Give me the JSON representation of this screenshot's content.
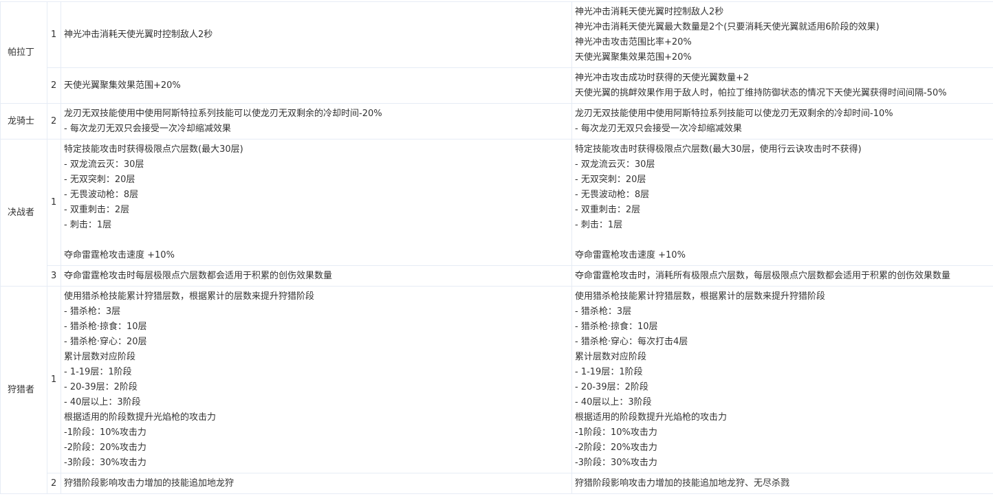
{
  "rows": [
    {
      "class": "帕拉丁",
      "entries": [
        {
          "level": "1",
          "before": [
            "神光冲击消耗天使光翼时控制敌人2秒"
          ],
          "after": [
            "神光冲击消耗天使光翼时控制敌人2秒",
            "神光冲击消耗天使光翼最大数量是2个(只要消耗天使光翼就适用6阶段的效果)",
            "神光冲击攻击范围比率+20%",
            "天使光翼聚集效果范围+20%"
          ]
        },
        {
          "level": "2",
          "before": [
            "天使光翼聚集效果范围+20%"
          ],
          "after": [
            "神光冲击攻击成功时获得的天使光翼数量+2",
            "天使光翼的挑衅效果作用于敌人时，帕拉丁维持防御状态的情况下天使光翼获得时间间隔-50%"
          ]
        }
      ]
    },
    {
      "class": "龙骑士",
      "entries": [
        {
          "level": "2",
          "before": [
            "龙刃无双技能使用中使用阿斯特拉系列技能可以使龙刃无双剩余的冷却时间-20%",
            "- 每次龙刃无双只会接受一次冷却缩减效果"
          ],
          "after": [
            "龙刃无双技能使用中使用阿斯特拉系列技能可以使龙刃无双剩余的冷却时间-10%",
            "- 每次龙刃无双只会接受一次冷却缩减效果"
          ]
        }
      ]
    },
    {
      "class": "决战者",
      "entries": [
        {
          "level": "1",
          "before": [
            "特定技能攻击时获得极限点穴层数(最大30层)",
            "- 双龙流云灭：30层",
            "- 无双突刺：20层",
            "- 无畏波动枪：8层",
            "- 双重刺击：2层",
            "- 刺击：1层",
            "",
            "夺命雷霆枪攻击速度 +10%"
          ],
          "after": [
            "特定技能攻击时获得极限点穴层数(最大30层，使用行云诀攻击时不获得)",
            "- 双龙流云灭：30层",
            "- 无双突刺：20层",
            "- 无畏波动枪：8层",
            "- 双重刺击：2层",
            "- 刺击：1层",
            "",
            "夺命雷霆枪攻击速度 +10%"
          ]
        },
        {
          "level": "3",
          "before": [
            "夺命雷霆枪攻击时每层极限点穴层数都会适用于积累的创伤效果数量"
          ],
          "after": [
            "夺命雷霆枪攻击时，消耗所有极限点穴层数，每层极限点穴层数都会适用于积累的创伤效果数量"
          ]
        }
      ]
    },
    {
      "class": "狩猎者",
      "entries": [
        {
          "level": "1",
          "before": [
            "使用猎杀枪技能累计狩猎层数，根据累计的层数来提升狩猎阶段",
            "- 猎杀枪：3层",
            "- 猎杀枪·掠食：10层",
            "- 猎杀枪·穿心：20层",
            "累计层数对应阶段",
            "- 1-19层：1阶段",
            "- 20-39层：2阶段",
            "- 40层以上：3阶段",
            "根据适用的阶段数提升光焰枪的攻击力",
            "-1阶段：10%攻击力",
            "-2阶段：20%攻击力",
            "-3阶段：30%攻击力"
          ],
          "after": [
            "使用猎杀枪技能累计狩猎层数，根据累计的层数来提升狩猎阶段",
            "- 猎杀枪：3层",
            "- 猎杀枪·掠食：10层",
            "- 猎杀枪·穿心：每次打击4层",
            "累计层数对应阶段",
            "- 1-19层：1阶段",
            "- 20-39层：2阶段",
            "- 40层以上：3阶段",
            "根据适用的阶段数提升光焰枪的攻击力",
            "-1阶段：10%攻击力",
            "-2阶段：20%攻击力",
            "-3阶段：30%攻击力"
          ]
        },
        {
          "level": "2",
          "before": [
            "狩猎阶段影响攻击力增加的技能追加地龙狩"
          ],
          "after": [
            "狩猎阶段影响攻击力增加的技能追加地龙狩、无尽杀戮"
          ]
        }
      ]
    }
  ]
}
